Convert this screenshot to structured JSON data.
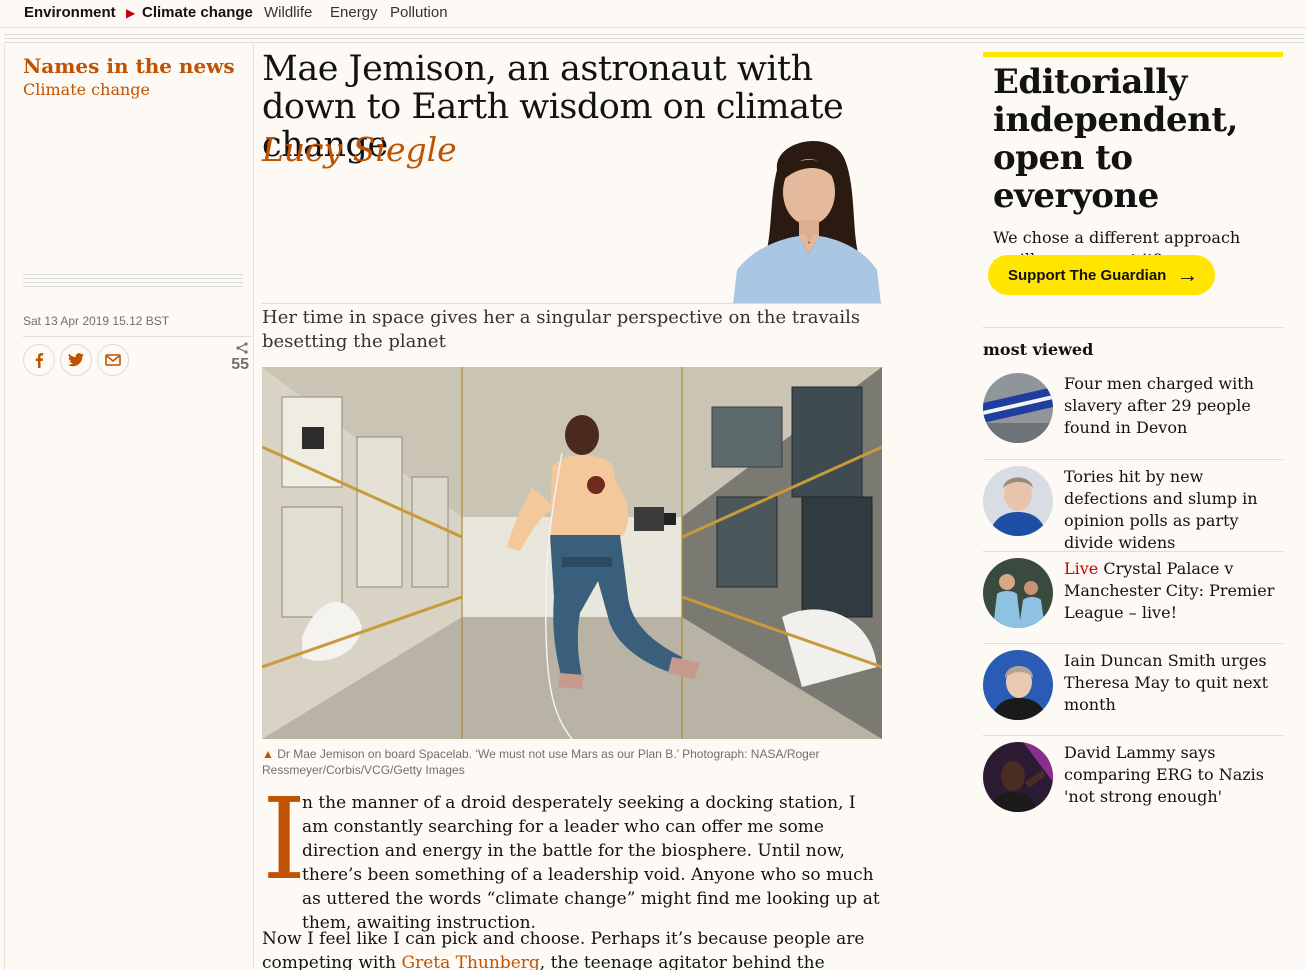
{
  "nav": {
    "items": [
      "Environment",
      "Climate change",
      "Wildlife",
      "Energy",
      "Pollution"
    ],
    "active_arrow": "▶"
  },
  "article_meta": {
    "series": "Names in the news",
    "section": "Climate change",
    "date": "Sat 13 Apr 2019 15.12 BST",
    "share_count": "55",
    "share_buttons": [
      "facebook-icon",
      "twitter-icon",
      "email-icon"
    ]
  },
  "article": {
    "headline": "Mae Jemison, an astronaut with down to Earth wisdom on climate change",
    "byline": "Lucy Siegle",
    "standfirst": "Her time in space gives her a singular perspective on the travails besetting the planet",
    "caption_icon": "▲",
    "caption": "Dr Mae Jemison on board Spacelab. ‘We must not use Mars as our Plan B.’ Photograph: NASA/Roger Ressmeyer/Corbis/VCG/Getty Images",
    "dropcap": "I",
    "para1": "n the manner of a droid desperately seeking a docking station, I am constantly searching for a leader who can offer me some direction and energy in the battle for the biosphere. Until now, there’s been something of a leadership void. Anyone who so much as uttered the words “climate change” might find me looking up at them, awaiting instruction.",
    "para2_start": "Now I feel like I can pick and choose. Perhaps it’s because people are competing with ",
    "para2_link": "Greta Thunberg",
    "para2_end": ", the teenage agitator behind the climate"
  },
  "support": {
    "heading": "Editorially independent, open to everyone",
    "text": "We chose a different approach – will you support it?",
    "button": "Support The Guardian",
    "button_arrow": "→"
  },
  "most_viewed": {
    "title": "most viewed",
    "items": [
      {
        "text": "Four men charged with slavery after 29 people found in Devon",
        "live": ""
      },
      {
        "text": "Tories hit by new defections and slump in opinion polls as party divide widens",
        "live": ""
      },
      {
        "text": "Crystal Palace v Manchester City: Premier League – live!",
        "live": "Live"
      },
      {
        "text": "Iain Duncan Smith urges Theresa May to quit next month",
        "live": ""
      },
      {
        "text": "David Lammy says comparing ERG to Nazis 'not strong enough'",
        "live": ""
      }
    ]
  },
  "colors": {
    "accent": "#c05303",
    "live_red": "#c70000",
    "support_yellow": "#ffe500",
    "background": "#fdf9f4"
  }
}
